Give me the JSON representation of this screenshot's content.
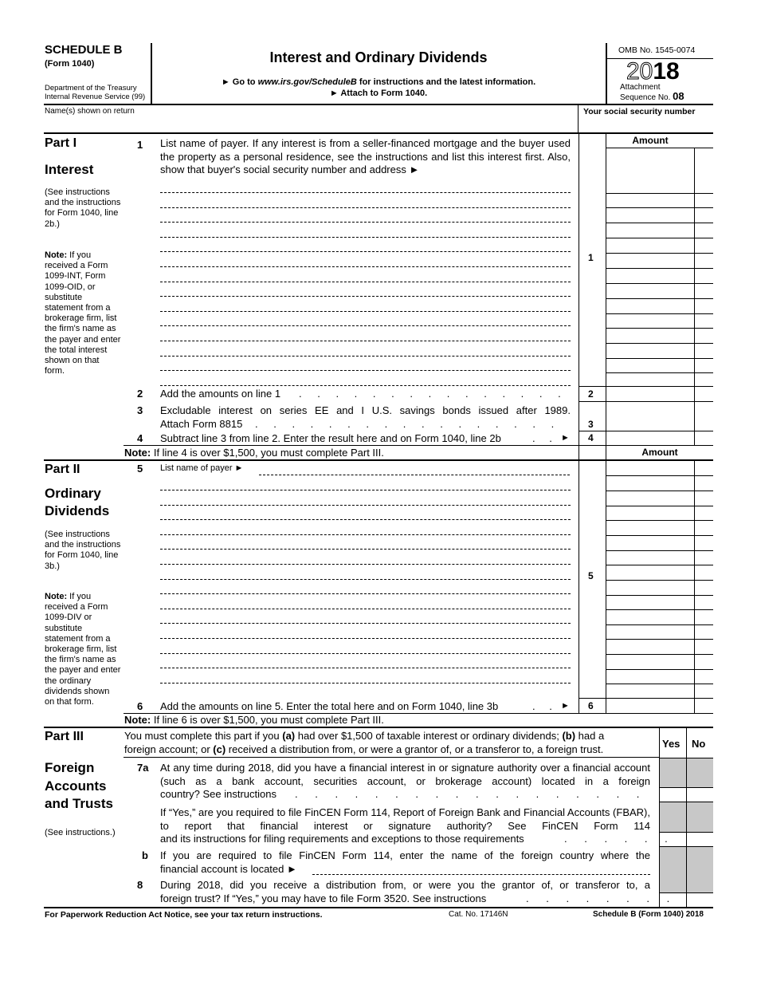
{
  "header": {
    "schedule": "SCHEDULE B",
    "form": "(Form 1040)",
    "dept_line1": "Department of the Treasury",
    "dept_line2": "Internal Revenue Service (99)",
    "title": "Interest and Ordinary Dividends",
    "goto_prefix": "► Go to ",
    "goto_url": "www.irs.gov/ScheduleB",
    "goto_suffix": " for instructions and the latest information.",
    "attach": "► Attach to Form 1040.",
    "omb": "OMB No. 1545-0074",
    "year_outline": "20",
    "year_bold": "18",
    "attachment_label": "Attachment",
    "sequence_label": "Sequence No.",
    "sequence_no": "08",
    "names_label": "Name(s) shown on return",
    "ssn_label": "Your social security number",
    "names_value": "",
    "ssn_value": ""
  },
  "part1": {
    "part": "Part I",
    "title": "Interest",
    "see": "(See instructions and the instructions for Form 1040, line 2b.)",
    "note_bold": "Note:",
    "note": " If you received a Form 1099-INT, Form 1099-OID, or substitute statement from a brokerage firm, list the firm's name as the payer and enter the total interest shown on that form.",
    "amount_header": "Amount",
    "line1_num": "1",
    "line1_text": "List name of payer. If any interest is from a seller-financed mortgage and the buyer used the property as a personal residence, see the instructions and list this interest first. Also, show that buyer's social security number and address ►",
    "line2_num": "2",
    "line2_text": "Add the amounts on line 1",
    "line3_num": "3",
    "line3_text_a": "Excludable interest on series EE and I U.S. savings bonds issued after 1989.",
    "line3_text_b": "Attach Form 8815",
    "line4_num": "4",
    "line4_text": "Subtract line 3 from line 2. Enter the result here and on Form 1040, line 2b",
    "note2_bold": "Note:",
    "note2": " If line 4 is over $1,500, you must complete Part III.",
    "arrow": "►"
  },
  "part2": {
    "part": "Part II",
    "title_a": "Ordinary",
    "title_b": "Dividends",
    "see": "(See instructions and the instructions for Form 1040, line 3b.)",
    "note_bold": "Note:",
    "note": " If you received a Form 1099-DIV or substitute statement from a brokerage firm, list the firm's name as the payer and enter the ordinary dividends shown on that form.",
    "amount_header": "Amount",
    "line5_num": "5",
    "line5_text": "List name of payer ►",
    "line6_num": "6",
    "line6_text": "Add the amounts on line 5. Enter the total here and on Form 1040, line 3b",
    "note2_bold": "Note:",
    "note2": " If line 6 is over $1,500, you must complete Part III.",
    "arrow": "►"
  },
  "part3": {
    "part": "Part III",
    "title_a": "Foreign",
    "title_b": "Accounts",
    "title_c": "and Trusts",
    "see": "(See instructions.)",
    "intro_1": "You must complete this part if you ",
    "intro_a": "(a)",
    "intro_2": " had over $1,500 of taxable interest or ordinary dividends; ",
    "intro_b": "(b)",
    "intro_3": " had a",
    "intro_4": "foreign account; or ",
    "intro_c": "(c)",
    "intro_5": " received a distribution from, or were a grantor of, or a transferor to, a foreign trust.",
    "yes": "Yes",
    "no": "No",
    "line7a_num": "7a",
    "line7a_text": "At any time during 2018, did you have a financial interest in or signature authority over a financial account (such as a bank account, securities account, or brokerage account) located in a foreign",
    "line7a_last": "country? See instructions",
    "line7a_fbar": "If “Yes,” are you required to file FinCEN Form 114, Report of Foreign Bank and Financial Accounts (FBAR), to report that financial interest or signature authority? See FinCEN Form 114",
    "line7a_fbar_last": "and its instructions for filing requirements and exceptions to those requirements",
    "line7b_num": "b",
    "line7b_text": "If you are required to file FinCEN Form 114, enter the name of the foreign country where the",
    "line7b_last": "financial account is located ►",
    "line8_num": "8",
    "line8_text": "During 2018, did you receive a distribution from, or were you the grantor of, or transferor to, a",
    "line8_last": "foreign trust? If “Yes,” you may have to file Form 3520. See instructions"
  },
  "footer": {
    "paperwork": "For Paperwork Reduction Act Notice, see your tax return instructions.",
    "cat": "Cat. No. 17146N",
    "form_ref_a": "Schedule B (Form 1040) ",
    "form_ref_b": "2018"
  }
}
